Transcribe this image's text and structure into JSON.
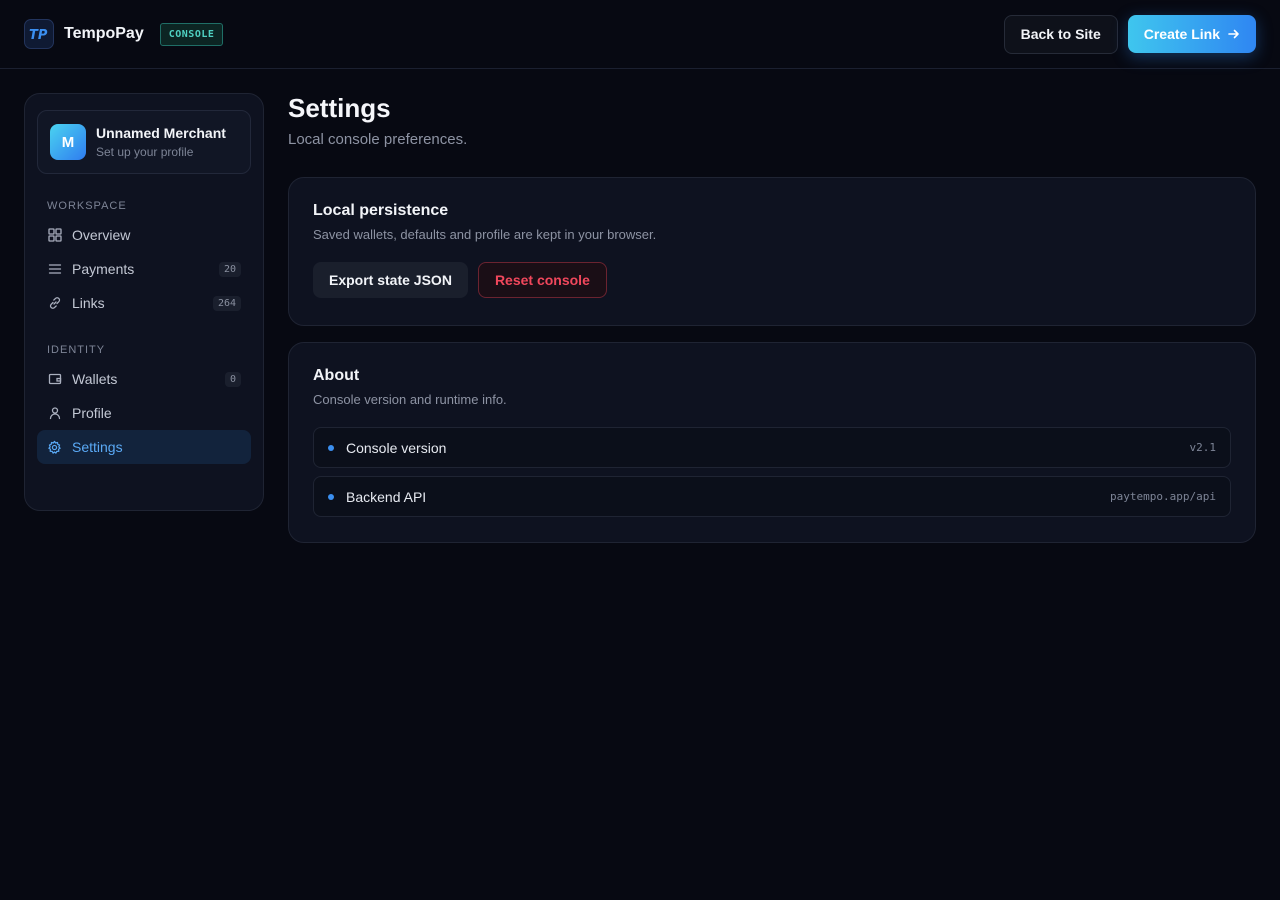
{
  "header": {
    "brand_name": "TempoPay",
    "logo_text": "TP",
    "badge": "CONSOLE",
    "back_label": "Back to Site",
    "create_label": "Create Link",
    "create_icon": "arrow-right-icon"
  },
  "sidebar": {
    "merchant": {
      "initial": "M",
      "name": "Unnamed Merchant",
      "subtitle": "Set up your profile"
    },
    "sections": [
      {
        "label": "WORKSPACE",
        "items": [
          {
            "label": "Overview",
            "icon": "grid-icon"
          },
          {
            "label": "Payments",
            "icon": "list-icon",
            "count": "20"
          },
          {
            "label": "Links",
            "icon": "link-icon",
            "count": "264"
          }
        ]
      },
      {
        "label": "IDENTITY",
        "items": [
          {
            "label": "Wallets",
            "icon": "wallet-icon",
            "count": "0"
          },
          {
            "label": "Profile",
            "icon": "user-icon"
          },
          {
            "label": "Settings",
            "icon": "gear-icon",
            "active": true
          }
        ]
      }
    ]
  },
  "main": {
    "title": "Settings",
    "subtitle": "Local console preferences.",
    "persistence": {
      "title": "Local persistence",
      "description": "Saved wallets, defaults and profile are kept in your browser.",
      "export_label": "Export state JSON",
      "reset_label": "Reset console"
    },
    "about": {
      "title": "About",
      "description": "Console version and runtime info.",
      "rows": [
        {
          "label": "Console version",
          "value": "v2.1"
        },
        {
          "label": "Backend API",
          "value": "paytempo.app/api"
        }
      ]
    }
  },
  "colors": {
    "background": "#070912",
    "accent": "#3b8ff0",
    "danger": "#f0475c",
    "badge": "#4fd1c2"
  }
}
